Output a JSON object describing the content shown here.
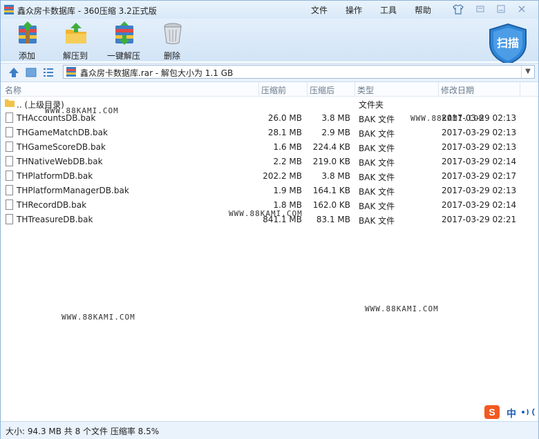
{
  "title": {
    "text": "鑫众房卡数据库 - 360压缩 3.2正式版"
  },
  "menu": [
    {
      "label": "文件"
    },
    {
      "label": "操作"
    },
    {
      "label": "工具"
    },
    {
      "label": "帮助"
    }
  ],
  "toolbar": {
    "buttons": [
      {
        "label": "添加",
        "icon": "add-archive-icon"
      },
      {
        "label": "解压到",
        "icon": "extract-to-icon"
      },
      {
        "label": "一键解压",
        "icon": "one-click-extract-icon"
      },
      {
        "label": "删除",
        "icon": "trash-icon"
      }
    ],
    "scan_label": "扫描"
  },
  "address": {
    "text": "鑫众房卡数据库.rar - 解包大小为 1.1 GB"
  },
  "columns": {
    "name": "名称",
    "packed": "压缩前",
    "unpacked": "压缩后",
    "type": "类型",
    "modified": "修改日期"
  },
  "parent_row": {
    "name": ".. (上级目录)",
    "type": "文件夹"
  },
  "files": [
    {
      "name": "THAccountsDB.bak",
      "before": "26.0 MB",
      "after": "3.8 MB",
      "type": "BAK 文件",
      "date": "2017-03-29 02:13"
    },
    {
      "name": "THGameMatchDB.bak",
      "before": "28.1 MB",
      "after": "2.9 MB",
      "type": "BAK 文件",
      "date": "2017-03-29 02:13"
    },
    {
      "name": "THGameScoreDB.bak",
      "before": "1.6 MB",
      "after": "224.4 KB",
      "type": "BAK 文件",
      "date": "2017-03-29 02:13"
    },
    {
      "name": "THNativeWebDB.bak",
      "before": "2.2 MB",
      "after": "219.0 KB",
      "type": "BAK 文件",
      "date": "2017-03-29 02:14"
    },
    {
      "name": "THPlatformDB.bak",
      "before": "202.2 MB",
      "after": "3.8 MB",
      "type": "BAK 文件",
      "date": "2017-03-29 02:17"
    },
    {
      "name": "THPlatformManagerDB.bak",
      "before": "1.9 MB",
      "after": "164.1 KB",
      "type": "BAK 文件",
      "date": "2017-03-29 02:13"
    },
    {
      "name": "THRecordDB.bak",
      "before": "1.8 MB",
      "after": "162.0 KB",
      "type": "BAK 文件",
      "date": "2017-03-29 02:14"
    },
    {
      "name": "THTreasureDB.bak",
      "before": "841.1 MB",
      "after": "83.1 MB",
      "type": "BAK 文件",
      "date": "2017-03-29 02:21"
    }
  ],
  "watermark": "WWW.88KAMI.COM",
  "status": {
    "text": "大小: 94.3 MB 共 8 个文件 压缩率 8.5%"
  },
  "ime": {
    "label": "中"
  },
  "colors": {
    "accent": "#2b79c2",
    "scan_shield": "#2f86d6"
  }
}
